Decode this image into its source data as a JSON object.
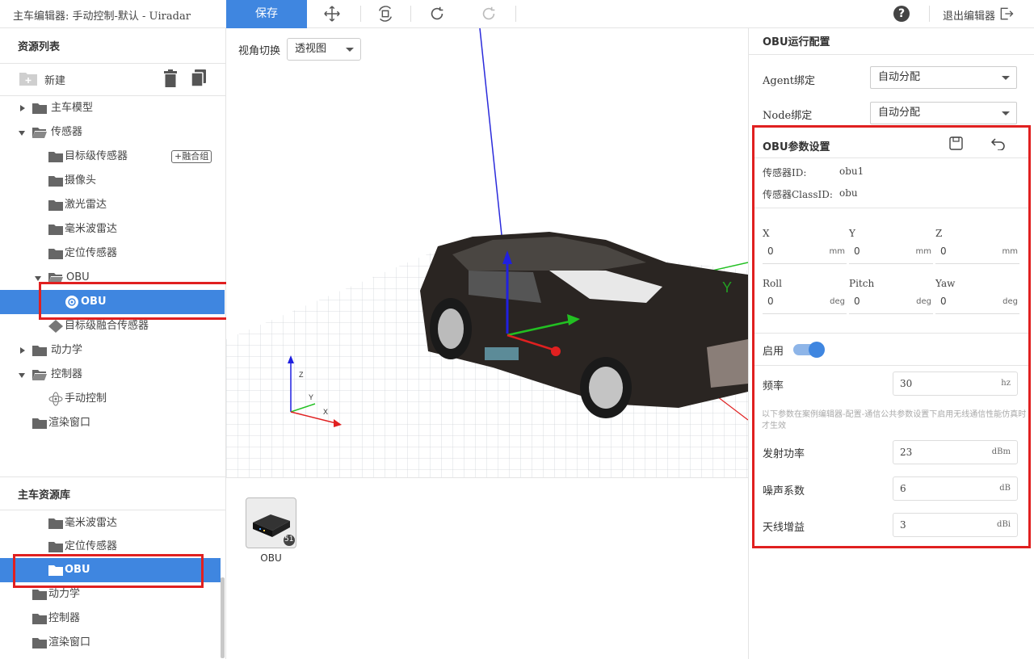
{
  "app": {
    "title": "主车编辑器: 手动控制-默认 - Uiradar"
  },
  "toolbar": {
    "save_label": "保存",
    "help_label": "?",
    "exit_label": "退出编辑器"
  },
  "left_panel": {
    "resource_title": "资源列表",
    "new_label": "新建",
    "tree": [
      {
        "label": "主车模型",
        "type": "folder",
        "expanded": false
      },
      {
        "label": "传感器",
        "type": "folder",
        "expanded": true
      },
      {
        "label": "目标级传感器",
        "type": "folder",
        "tag": "+融合组"
      },
      {
        "label": "摄像头",
        "type": "folder"
      },
      {
        "label": "激光雷达",
        "type": "folder"
      },
      {
        "label": "毫米波雷达",
        "type": "folder"
      },
      {
        "label": "定位传感器",
        "type": "folder"
      },
      {
        "label": "OBU",
        "type": "folder",
        "expanded": true
      },
      {
        "label": "OBU",
        "type": "item",
        "selected": true
      },
      {
        "label": "目标级融合传感器",
        "type": "item"
      },
      {
        "label": "动力学",
        "type": "folder",
        "expanded": false
      },
      {
        "label": "控制器",
        "type": "folder",
        "expanded": true
      },
      {
        "label": "手动控制",
        "type": "item"
      },
      {
        "label": "渲染窗口",
        "type": "folder"
      }
    ],
    "library_title": "主车资源库",
    "library": [
      {
        "label": "毫米波雷达"
      },
      {
        "label": "定位传感器"
      },
      {
        "label": "OBU",
        "selected": true
      },
      {
        "label": "动力学"
      },
      {
        "label": "控制器"
      },
      {
        "label": "渲染窗口"
      }
    ]
  },
  "viewport": {
    "view_label": "视角切换",
    "view_value": "透视图",
    "axis_labels": [
      "Z",
      "Y",
      "X"
    ],
    "big_axis_label": "Y"
  },
  "assets": [
    {
      "label": "OBU",
      "badge": "51"
    }
  ],
  "right_panel": {
    "run_title": "OBU运行配置",
    "agent_label": "Agent绑定",
    "agent_value": "自动分配",
    "node_label": "Node绑定",
    "node_value": "自动分配",
    "param_title": "OBU参数设置",
    "sensor_id_label": "传感器ID:",
    "sensor_id_value": "obu1",
    "class_id_label": "传感器ClassID:",
    "class_id_value": "obu",
    "position": [
      {
        "label": "X",
        "value": "0",
        "unit": "mm"
      },
      {
        "label": "Y",
        "value": "0",
        "unit": "mm"
      },
      {
        "label": "Z",
        "value": "0",
        "unit": "mm"
      }
    ],
    "rotation": [
      {
        "label": "Roll",
        "value": "0",
        "unit": "deg"
      },
      {
        "label": "Pitch",
        "value": "0",
        "unit": "deg"
      },
      {
        "label": "Yaw",
        "value": "0",
        "unit": "deg"
      }
    ],
    "enable_label": "启用",
    "enabled": true,
    "freq_label": "频率",
    "freq_value": "30",
    "freq_unit": "hz",
    "note": "以下参数在案例编辑器-配置-通信公共参数设置下启用无线通信性能仿真时才生效",
    "power_label": "发射功率",
    "power_value": "23",
    "power_unit": "dBm",
    "noise_label": "噪声系数",
    "noise_value": "6",
    "noise_unit": "dB",
    "gain_label": "天线增益",
    "gain_value": "3",
    "gain_unit": "dBi"
  },
  "colors": {
    "accent": "#3f86e0",
    "highlight": "#e02020"
  }
}
